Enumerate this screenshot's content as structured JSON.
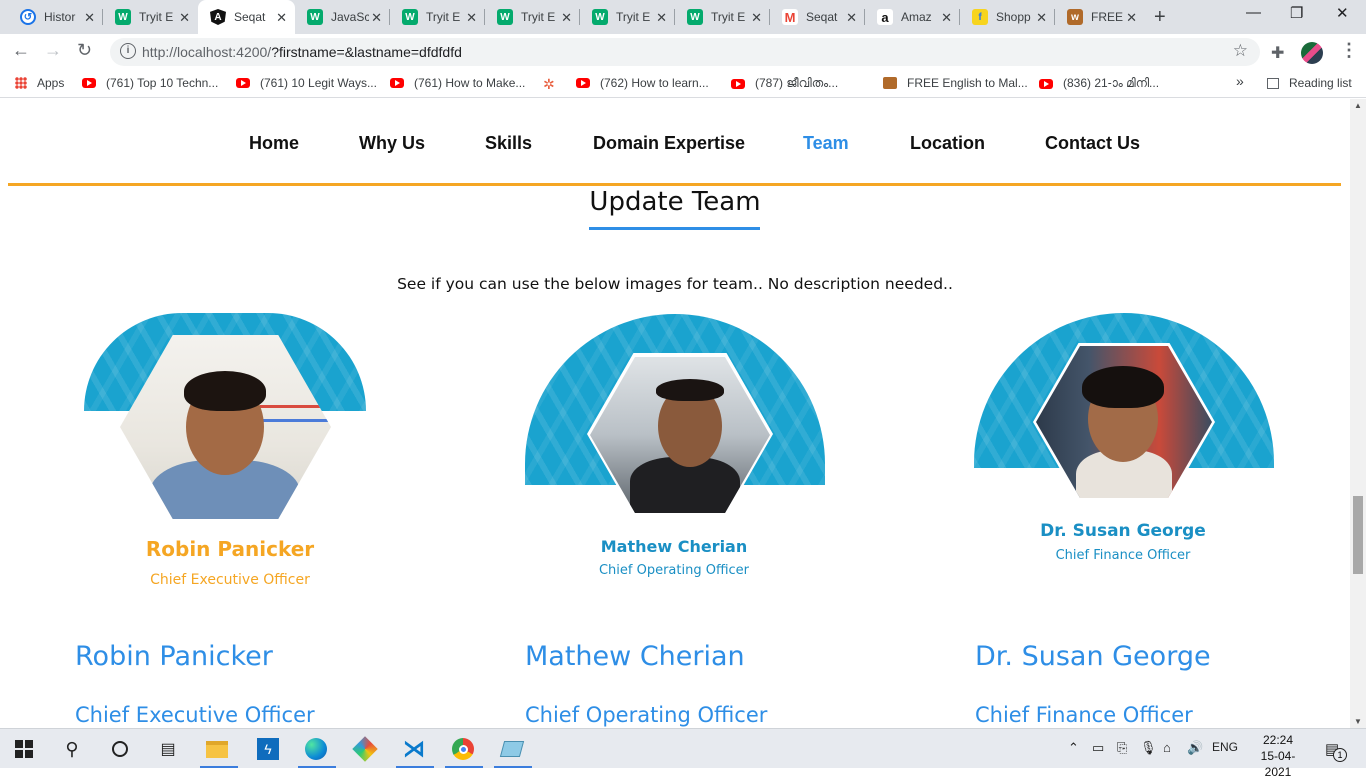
{
  "browser": {
    "tabs": [
      {
        "title": "History",
        "favicon": "history-icon",
        "active": false
      },
      {
        "title": "Tryit Editor",
        "favicon": "w3schools-icon",
        "active": false
      },
      {
        "title": "Seqat",
        "favicon": "angular-icon",
        "active": true
      },
      {
        "title": "JavaScript",
        "favicon": "w3schools-icon",
        "active": false
      },
      {
        "title": "Tryit Editor",
        "favicon": "w3schools-icon",
        "active": false
      },
      {
        "title": "Tryit Editor",
        "favicon": "w3schools-icon",
        "active": false
      },
      {
        "title": "Tryit Editor",
        "favicon": "w3schools-icon",
        "active": false
      },
      {
        "title": "Tryit Editor",
        "favicon": "w3schools-icon",
        "active": false
      },
      {
        "title": "Seqat",
        "favicon": "gmail-icon",
        "active": false
      },
      {
        "title": "Amazon",
        "favicon": "amazon-icon",
        "active": false
      },
      {
        "title": "Shopping",
        "favicon": "flipkart-icon",
        "active": false
      },
      {
        "title": "FREE",
        "favicon": "site-icon",
        "active": false
      }
    ],
    "tab_display": [
      "Histor",
      "Tryit E",
      "Seqat",
      "JavaSc",
      "Tryit E",
      "Tryit E",
      "Tryit E",
      "Tryit E",
      "Seqat",
      "Amaz",
      "Shopp",
      "FREE"
    ],
    "url_host": "http://localhost:4200/",
    "url_query": "?firstname=&lastname=dfdfdfd",
    "bookmarks": [
      {
        "label": "Apps",
        "icon": "apps-grid-icon"
      },
      {
        "label": "(761) Top 10 Techn...",
        "icon": "youtube-icon"
      },
      {
        "label": "(761) 10 Legit Ways...",
        "icon": "youtube-icon"
      },
      {
        "label": "(761) How to Make...",
        "icon": "youtube-icon"
      },
      {
        "label": "",
        "icon": "pinwheel-icon"
      },
      {
        "label": "(762) How to learn...",
        "icon": "youtube-icon"
      },
      {
        "label": "(787) ജീവിതം...",
        "icon": "youtube-icon"
      },
      {
        "label": "FREE English to Mal...",
        "icon": "site-icon"
      },
      {
        "label": "(836) 21-ാം മിനി...",
        "icon": "youtube-icon"
      }
    ],
    "more_bookmarks": "»",
    "reading_list": "Reading list"
  },
  "site": {
    "nav": [
      "Home",
      "Why Us",
      "Skills",
      "Domain Expertise",
      "Team",
      "Location",
      "Contact Us"
    ],
    "active_nav": "Team",
    "section_title": "Update Team",
    "note": "See if you can use the below images for team.. No description needed..",
    "cards": [
      {
        "name": "Robin Panicker",
        "role": "Chief Executive Officer",
        "name_color": "#f5a623",
        "role_color": "#f5a623"
      },
      {
        "name": "Mathew Cherian",
        "role": "Chief Operating Officer",
        "name_color": "#1a8fc4",
        "role_color": "#1a8fc4"
      },
      {
        "name": "Dr. Susan George",
        "role": "Chief Finance Officer",
        "name_color": "#1a8fc4",
        "role_color": "#1a8fc4"
      }
    ],
    "members": [
      {
        "name": "Robin Panicker",
        "role": "Chief Executive Officer"
      },
      {
        "name": "Mathew Cherian",
        "role": "Chief Operating Officer"
      },
      {
        "name": "Dr. Susan George",
        "role": "Chief Finance Officer"
      }
    ]
  },
  "taskbar": {
    "apps": [
      "windows-start-icon",
      "search-icon",
      "cortana-icon",
      "task-view-icon",
      "file-explorer-icon",
      "powerautomate-icon",
      "edge-icon",
      "paint-icon",
      "vscode-icon",
      "chrome-icon",
      "notepad-icon"
    ],
    "language": "ENG",
    "time": "22:24",
    "date": "15-04-2021",
    "notification_count": "1"
  },
  "colors": {
    "accent_blue": "#2e8ee6",
    "accent_orange": "#f5a623",
    "dome_blue": "#1aa3cf"
  }
}
